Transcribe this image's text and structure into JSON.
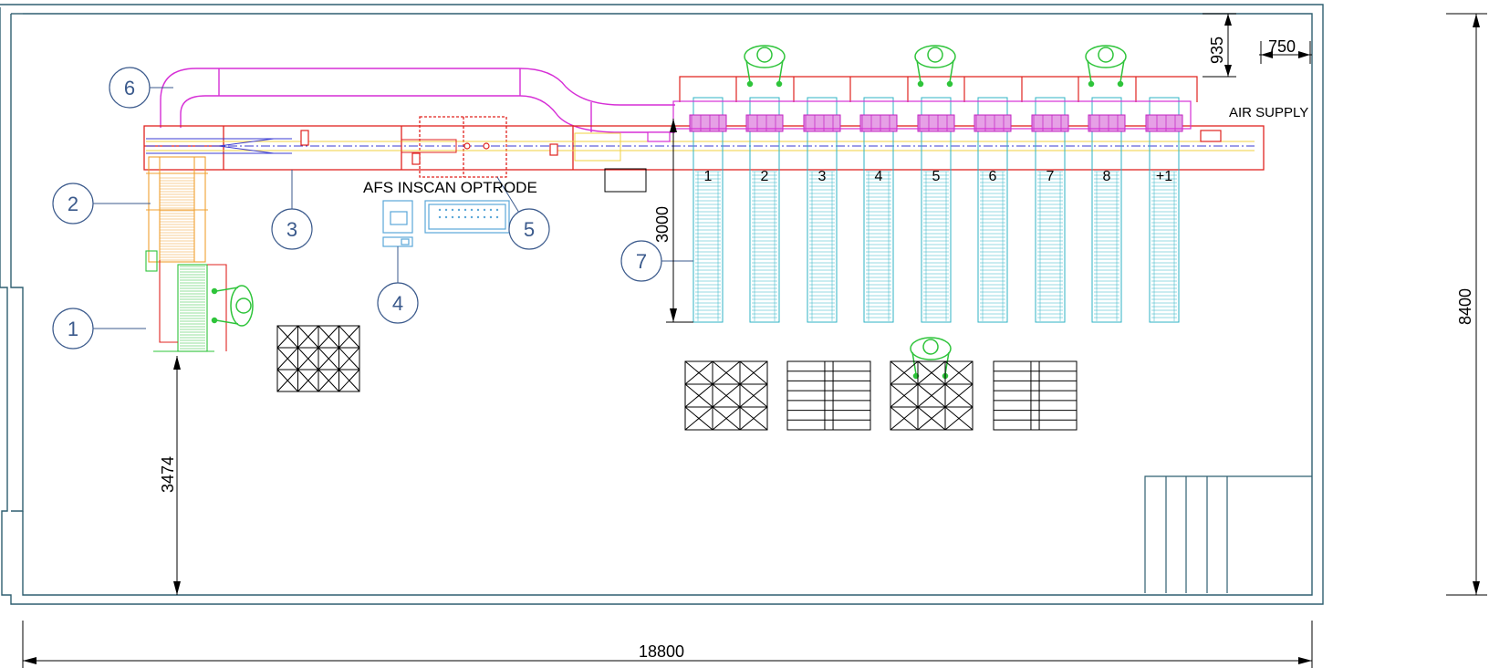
{
  "labels": {
    "afs_inscan_optrode": "AFS INSCAN OPTRODE",
    "air_supply": "AIR SUPPLY"
  },
  "callouts": [
    "1",
    "2",
    "3",
    "4",
    "5",
    "6",
    "7"
  ],
  "chutes": [
    "1",
    "2",
    "3",
    "4",
    "5",
    "6",
    "7",
    "8",
    "+1"
  ],
  "dimensions": {
    "overall_length": "18800",
    "overall_width": "8400",
    "infeed_offset": "3474",
    "chute_length": "3000",
    "frame_offset": "935",
    "operator_spacing": "750"
  },
  "colors": {
    "wall": "#2f5f70",
    "sorter_frame": "#e0231f",
    "return_loop": "#d62fd6",
    "chute": "#2fb3c6",
    "operator": "#2ec43a",
    "callout": "#3b5a8c",
    "infeed": "#f0a030",
    "induction": "#2ec43a"
  }
}
